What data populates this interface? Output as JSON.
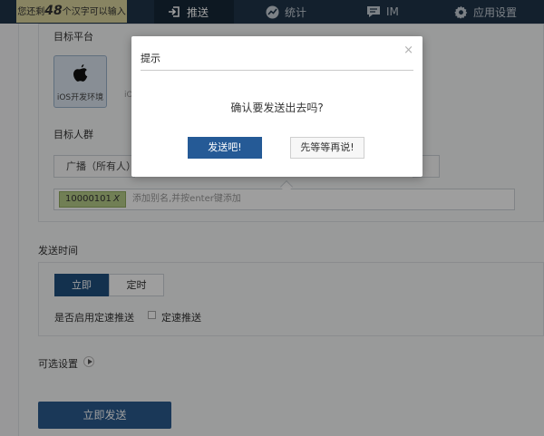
{
  "topbar": {
    "counter_prefix": "您还剩",
    "counter_number": "48",
    "counter_suffix": "个汉字可以输入",
    "nav": [
      {
        "label": "推送",
        "icon": "login-arrow-icon",
        "active": true
      },
      {
        "label": "统计",
        "icon": "stats-icon",
        "active": false
      },
      {
        "label": "IM",
        "icon": "chat-icon",
        "active": false
      },
      {
        "label": "应用设置",
        "icon": "gear-icon",
        "active": false
      }
    ]
  },
  "target": {
    "platform_title": "目标平台",
    "platform_ios_label": "iOS开发环境",
    "platform_peek": "iO",
    "audience_title": "目标人群",
    "broadcast_label": "广播（所有人）",
    "tag": "10000101",
    "tag_remove": "X",
    "tag_placeholder": "添加别名,并按enter键添加"
  },
  "send_time": {
    "title": "发送时间",
    "now": "立即",
    "scheduled": "定时",
    "rate_question": "是否启用定速推送",
    "rate_option": "定速推送"
  },
  "optional": {
    "title": "可选设置"
  },
  "send_button": "立即发送",
  "dialog": {
    "title": "提示",
    "close": "×",
    "message": "确认要发送出去吗?",
    "confirm": "发送吧!",
    "cancel": "先等等再说!"
  },
  "colors": {
    "nav_bg": "#1f3449",
    "counter_bg": "#dcd69e",
    "primary": "#255a96",
    "tag_bg": "#b7cd8a"
  }
}
